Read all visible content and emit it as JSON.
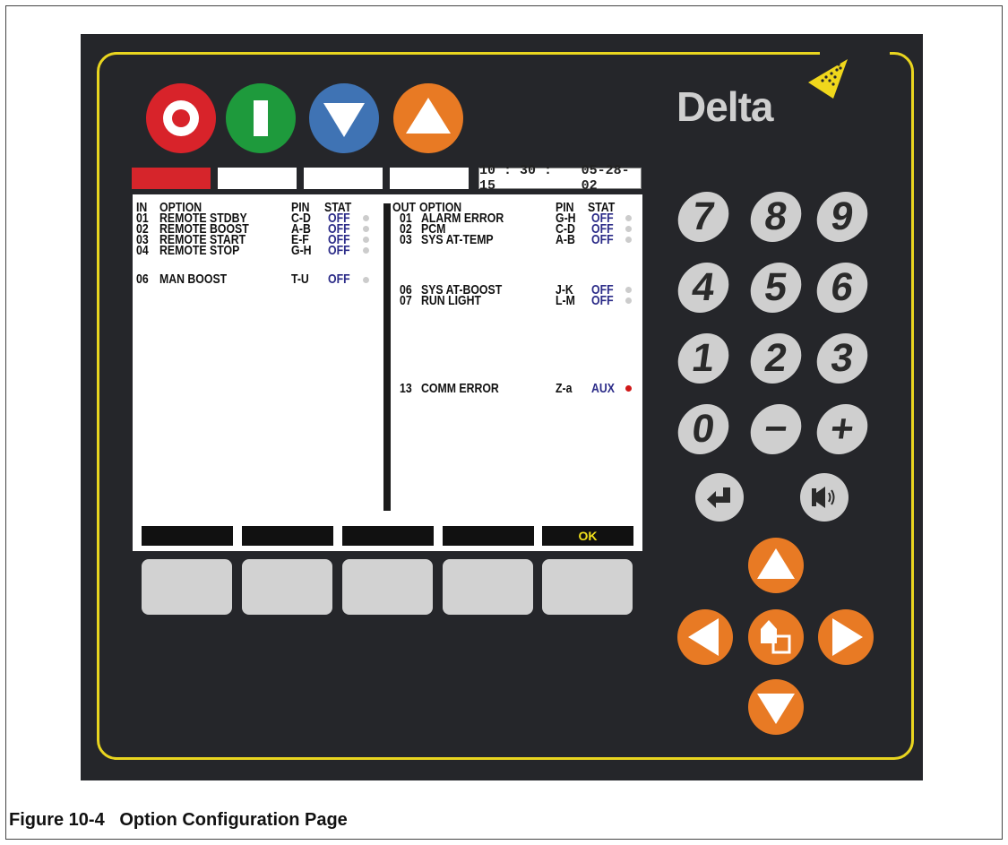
{
  "brand": {
    "logo_text": "Delta"
  },
  "status_bar": {
    "time": "10 : 30 : 15",
    "date": "05-28-02"
  },
  "in_table": {
    "header": {
      "num": "IN",
      "option": "OPTION",
      "pin": "PIN",
      "stat": "STAT"
    },
    "rows": [
      {
        "num": "01",
        "option": "REMOTE STDBY",
        "pin": "C-D",
        "stat": "OFF",
        "dot": "off"
      },
      {
        "num": "02",
        "option": "REMOTE BOOST",
        "pin": "A-B",
        "stat": "OFF",
        "dot": "off"
      },
      {
        "num": "03",
        "option": "REMOTE START",
        "pin": "E-F",
        "stat": "OFF",
        "dot": "off"
      },
      {
        "num": "04",
        "option": "REMOTE STOP",
        "pin": "G-H",
        "stat": "OFF",
        "dot": "off"
      },
      {
        "num": "06",
        "option": "MAN BOOST",
        "pin": "T-U",
        "stat": "OFF",
        "dot": "off"
      }
    ]
  },
  "out_table": {
    "header": {
      "num": "OUT",
      "option": "OPTION",
      "pin": "PIN",
      "stat": "STAT"
    },
    "rows": [
      {
        "num": "01",
        "option": "ALARM ERROR",
        "pin": "G-H",
        "stat": "OFF",
        "dot": "off"
      },
      {
        "num": "02",
        "option": "PCM",
        "pin": "C-D",
        "stat": "OFF",
        "dot": "off"
      },
      {
        "num": "03",
        "option": "SYS AT-TEMP",
        "pin": "A-B",
        "stat": "OFF",
        "dot": "off"
      },
      {
        "num": "06",
        "option": "SYS AT-BOOST",
        "pin": "J-K",
        "stat": "OFF",
        "dot": "off"
      },
      {
        "num": "07",
        "option": "RUN LIGHT",
        "pin": "L-M",
        "stat": "OFF",
        "dot": "off"
      },
      {
        "num": "13",
        "option": "COMM ERROR",
        "pin": "Z-a",
        "stat": "AUX",
        "dot": "on"
      }
    ]
  },
  "softkeys": {
    "labels": [
      "",
      "",
      "",
      "",
      "OK"
    ]
  },
  "keypad": {
    "keys": [
      "7",
      "8",
      "9",
      "4",
      "5",
      "6",
      "1",
      "2",
      "3",
      "0",
      "−",
      "+"
    ]
  },
  "caption": {
    "figure": "Figure 10-4",
    "title": "Option Configuration Page"
  },
  "colors": {
    "panel": "#25262a",
    "border": "#e9d51f",
    "orange": "#e87a24",
    "red": "#d8232a",
    "green": "#1e9a3c",
    "blue": "#3f73b4",
    "stat_text": "#2b2b88"
  },
  "icons": [
    "stop-icon",
    "start-icon",
    "down-arrow-icon",
    "up-arrow-icon",
    "enter-icon",
    "mute-icon",
    "page-toggle-icon",
    "left-arrow-icon",
    "right-arrow-icon"
  ]
}
